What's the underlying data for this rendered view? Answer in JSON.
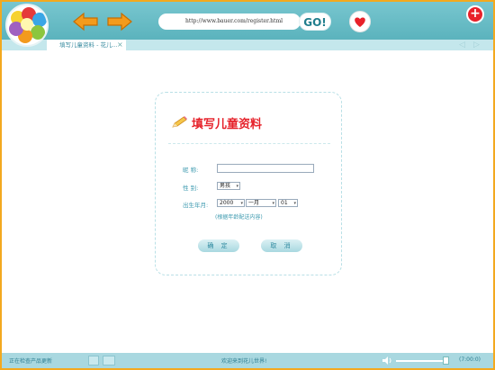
{
  "browser": {
    "address": "http://www.bauer.com/register.html",
    "go_label": "GO!",
    "close_symbol": "+"
  },
  "tab": {
    "label": "填写儿童资料 - 花儿...",
    "close_symbol": "×"
  },
  "form": {
    "title": "填写儿童资料",
    "nickname_label": "昵  称:",
    "gender_label": "性  别:",
    "gender_value": "男孩",
    "birthday_label": "出生年月:",
    "year_value": "2000",
    "month_value": "一月",
    "day_value": "01",
    "hint": "(根据年龄配送内容)",
    "confirm_label": "确 定",
    "cancel_label": "取 消"
  },
  "statusbar": {
    "left_text": "正在检查产品更新",
    "center_text": "欢迎来到花儿世界!",
    "time_text": "(7:00:0)"
  },
  "colors": {
    "accent": "#5bb3bd",
    "frame": "#f3a91f",
    "title_red": "#e6212a"
  },
  "icons": {
    "back": "back-arrow-icon",
    "forward": "forward-arrow-icon",
    "favorite": "heart-icon",
    "close": "close-icon",
    "pencil": "pencil-icon",
    "speaker": "speaker-icon"
  }
}
